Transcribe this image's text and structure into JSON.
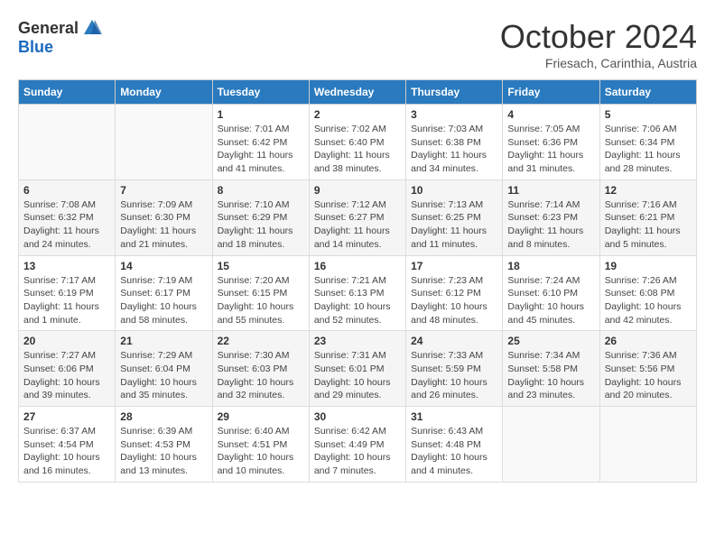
{
  "logo": {
    "general": "General",
    "blue": "Blue"
  },
  "title": "October 2024",
  "subtitle": "Friesach, Carinthia, Austria",
  "days_of_week": [
    "Sunday",
    "Monday",
    "Tuesday",
    "Wednesday",
    "Thursday",
    "Friday",
    "Saturday"
  ],
  "weeks": [
    [
      {
        "day": "",
        "info": ""
      },
      {
        "day": "",
        "info": ""
      },
      {
        "day": "1",
        "info": "Sunrise: 7:01 AM\nSunset: 6:42 PM\nDaylight: 11 hours and 41 minutes."
      },
      {
        "day": "2",
        "info": "Sunrise: 7:02 AM\nSunset: 6:40 PM\nDaylight: 11 hours and 38 minutes."
      },
      {
        "day": "3",
        "info": "Sunrise: 7:03 AM\nSunset: 6:38 PM\nDaylight: 11 hours and 34 minutes."
      },
      {
        "day": "4",
        "info": "Sunrise: 7:05 AM\nSunset: 6:36 PM\nDaylight: 11 hours and 31 minutes."
      },
      {
        "day": "5",
        "info": "Sunrise: 7:06 AM\nSunset: 6:34 PM\nDaylight: 11 hours and 28 minutes."
      }
    ],
    [
      {
        "day": "6",
        "info": "Sunrise: 7:08 AM\nSunset: 6:32 PM\nDaylight: 11 hours and 24 minutes."
      },
      {
        "day": "7",
        "info": "Sunrise: 7:09 AM\nSunset: 6:30 PM\nDaylight: 11 hours and 21 minutes."
      },
      {
        "day": "8",
        "info": "Sunrise: 7:10 AM\nSunset: 6:29 PM\nDaylight: 11 hours and 18 minutes."
      },
      {
        "day": "9",
        "info": "Sunrise: 7:12 AM\nSunset: 6:27 PM\nDaylight: 11 hours and 14 minutes."
      },
      {
        "day": "10",
        "info": "Sunrise: 7:13 AM\nSunset: 6:25 PM\nDaylight: 11 hours and 11 minutes."
      },
      {
        "day": "11",
        "info": "Sunrise: 7:14 AM\nSunset: 6:23 PM\nDaylight: 11 hours and 8 minutes."
      },
      {
        "day": "12",
        "info": "Sunrise: 7:16 AM\nSunset: 6:21 PM\nDaylight: 11 hours and 5 minutes."
      }
    ],
    [
      {
        "day": "13",
        "info": "Sunrise: 7:17 AM\nSunset: 6:19 PM\nDaylight: 11 hours and 1 minute."
      },
      {
        "day": "14",
        "info": "Sunrise: 7:19 AM\nSunset: 6:17 PM\nDaylight: 10 hours and 58 minutes."
      },
      {
        "day": "15",
        "info": "Sunrise: 7:20 AM\nSunset: 6:15 PM\nDaylight: 10 hours and 55 minutes."
      },
      {
        "day": "16",
        "info": "Sunrise: 7:21 AM\nSunset: 6:13 PM\nDaylight: 10 hours and 52 minutes."
      },
      {
        "day": "17",
        "info": "Sunrise: 7:23 AM\nSunset: 6:12 PM\nDaylight: 10 hours and 48 minutes."
      },
      {
        "day": "18",
        "info": "Sunrise: 7:24 AM\nSunset: 6:10 PM\nDaylight: 10 hours and 45 minutes."
      },
      {
        "day": "19",
        "info": "Sunrise: 7:26 AM\nSunset: 6:08 PM\nDaylight: 10 hours and 42 minutes."
      }
    ],
    [
      {
        "day": "20",
        "info": "Sunrise: 7:27 AM\nSunset: 6:06 PM\nDaylight: 10 hours and 39 minutes."
      },
      {
        "day": "21",
        "info": "Sunrise: 7:29 AM\nSunset: 6:04 PM\nDaylight: 10 hours and 35 minutes."
      },
      {
        "day": "22",
        "info": "Sunrise: 7:30 AM\nSunset: 6:03 PM\nDaylight: 10 hours and 32 minutes."
      },
      {
        "day": "23",
        "info": "Sunrise: 7:31 AM\nSunset: 6:01 PM\nDaylight: 10 hours and 29 minutes."
      },
      {
        "day": "24",
        "info": "Sunrise: 7:33 AM\nSunset: 5:59 PM\nDaylight: 10 hours and 26 minutes."
      },
      {
        "day": "25",
        "info": "Sunrise: 7:34 AM\nSunset: 5:58 PM\nDaylight: 10 hours and 23 minutes."
      },
      {
        "day": "26",
        "info": "Sunrise: 7:36 AM\nSunset: 5:56 PM\nDaylight: 10 hours and 20 minutes."
      }
    ],
    [
      {
        "day": "27",
        "info": "Sunrise: 6:37 AM\nSunset: 4:54 PM\nDaylight: 10 hours and 16 minutes."
      },
      {
        "day": "28",
        "info": "Sunrise: 6:39 AM\nSunset: 4:53 PM\nDaylight: 10 hours and 13 minutes."
      },
      {
        "day": "29",
        "info": "Sunrise: 6:40 AM\nSunset: 4:51 PM\nDaylight: 10 hours and 10 minutes."
      },
      {
        "day": "30",
        "info": "Sunrise: 6:42 AM\nSunset: 4:49 PM\nDaylight: 10 hours and 7 minutes."
      },
      {
        "day": "31",
        "info": "Sunrise: 6:43 AM\nSunset: 4:48 PM\nDaylight: 10 hours and 4 minutes."
      },
      {
        "day": "",
        "info": ""
      },
      {
        "day": "",
        "info": ""
      }
    ]
  ]
}
